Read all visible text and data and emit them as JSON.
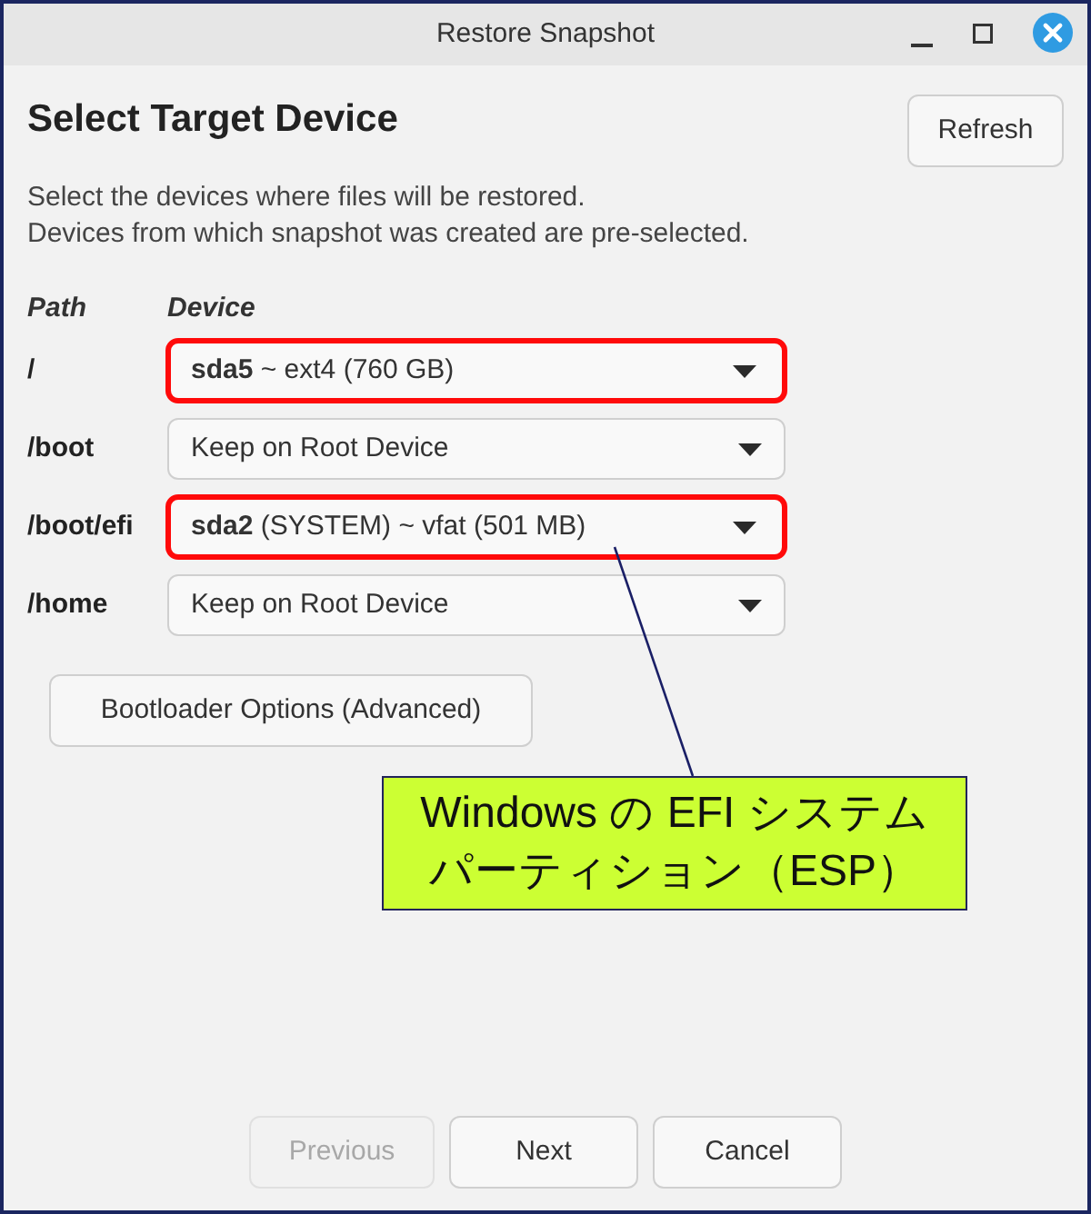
{
  "window": {
    "title": "Restore Snapshot"
  },
  "heading": "Select Target Device",
  "refresh_button": "Refresh",
  "description": [
    "Select the devices where files will be restored.",
    "Devices from which snapshot was created are pre-selected."
  ],
  "table": {
    "columns": [
      "Path",
      "Device"
    ],
    "rows": [
      {
        "path": "/",
        "device": "**sda5** ~ ext4 (760 GB)",
        "highlighted": true
      },
      {
        "path": "/boot",
        "device": "Keep on Root Device",
        "highlighted": false
      },
      {
        "path": "/boot/efi",
        "device": "**sda2** (SYSTEM) ~ vfat (501 MB)",
        "highlighted": true
      },
      {
        "path": "/home",
        "device": "Keep on Root Device",
        "highlighted": false
      }
    ]
  },
  "bootloader_button": "Bootloader Options (Advanced)",
  "callout": {
    "lines": [
      "Windows の EFI システム",
      "パーティション（ESP）"
    ]
  },
  "buttons": [
    {
      "label": "Previous",
      "disabled": true
    },
    {
      "label": "Next",
      "disabled": false
    },
    {
      "label": "Cancel",
      "disabled": false
    }
  ]
}
